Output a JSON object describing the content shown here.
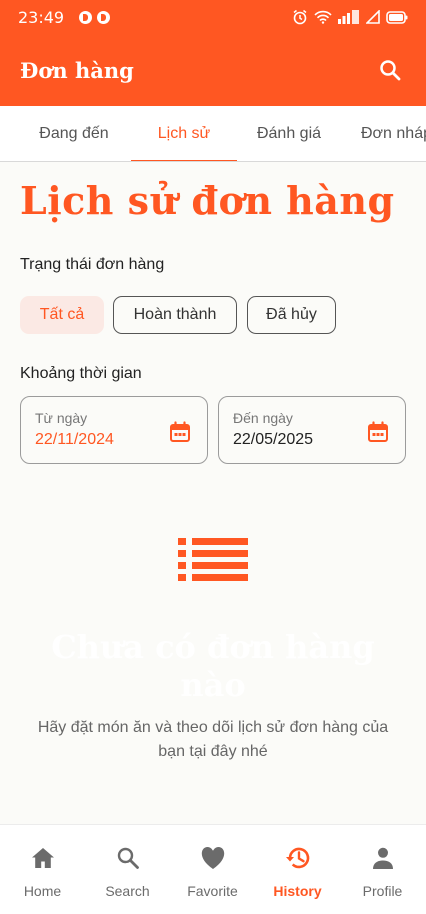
{
  "colors": {
    "accent": "#ff5722",
    "accent_light": "#fbe9e4",
    "text": "#222222",
    "muted": "#6b6b6b"
  },
  "status_bar": {
    "time": "23:49"
  },
  "app_bar": {
    "title": "Đơn hàng",
    "icon": "search-icon"
  },
  "tabs": [
    {
      "label": "Đang đến",
      "active": false
    },
    {
      "label": "Lịch sử",
      "active": true
    },
    {
      "label": "Đánh giá",
      "active": false
    },
    {
      "label": "Đơn nháp",
      "active": false
    }
  ],
  "page": {
    "heading": "Lịch sử đơn hàng"
  },
  "status_filter": {
    "label": "Trạng thái đơn hàng",
    "chips": [
      {
        "label": "Tất cả",
        "selected": true
      },
      {
        "label": "Hoàn thành",
        "selected": false
      },
      {
        "label": "Đã hủy",
        "selected": false
      }
    ]
  },
  "date_range": {
    "label": "Khoảng thời gian",
    "from": {
      "label": "Từ ngày",
      "value": "22/11/2024",
      "icon": "calendar-icon"
    },
    "to": {
      "label": "Đến ngày",
      "value": "22/05/2025",
      "icon": "calendar-icon"
    }
  },
  "empty_state": {
    "icon": "list-icon",
    "title": "Chưa có đơn hàng nào",
    "description": "Hãy đặt món ăn và theo dõi lịch sử đơn hàng của bạn tại đây nhé"
  },
  "bottom_nav": [
    {
      "label": "Home",
      "icon": "home-icon",
      "active": false
    },
    {
      "label": "Search",
      "icon": "search-icon",
      "active": false
    },
    {
      "label": "Favorite",
      "icon": "heart-icon",
      "active": false
    },
    {
      "label": "History",
      "icon": "history-icon",
      "active": true
    },
    {
      "label": "Profile",
      "icon": "person-icon",
      "active": false
    }
  ]
}
